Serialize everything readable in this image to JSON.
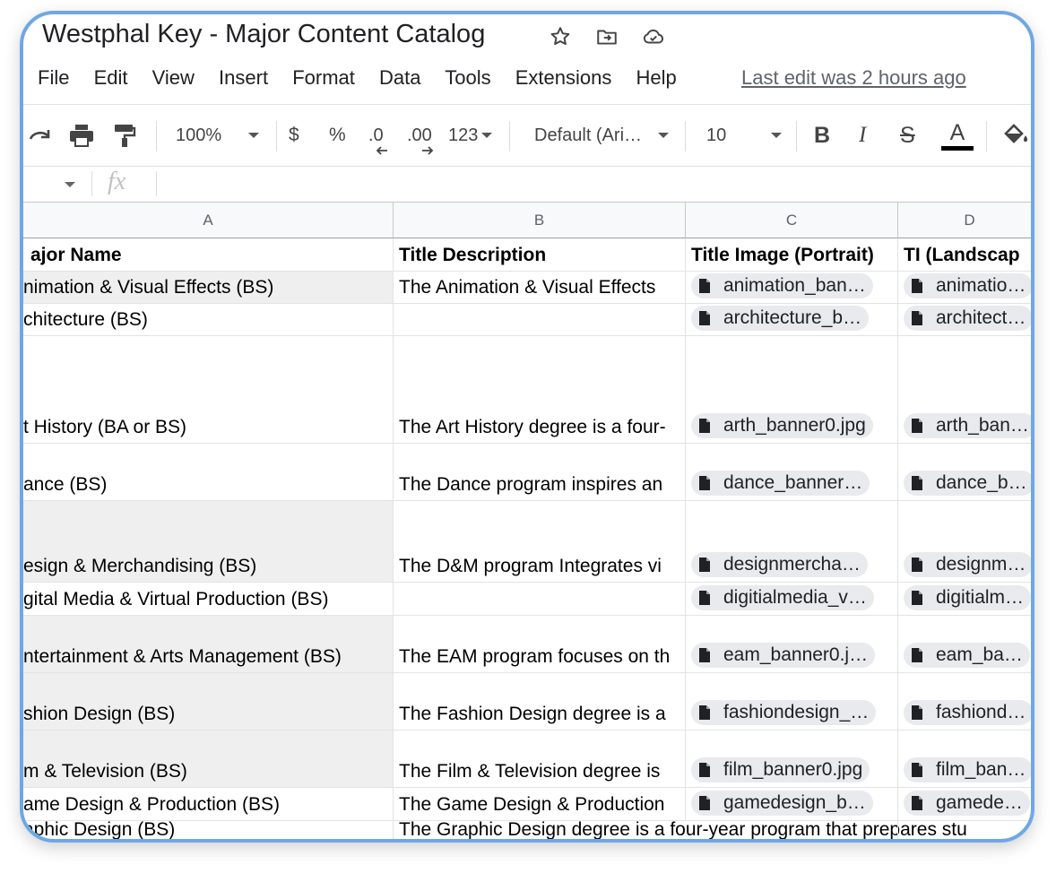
{
  "doc": {
    "title": "Westphal Key - Major Content Catalog",
    "last_edit": "Last edit was 2 hours ago"
  },
  "menu": [
    "File",
    "Edit",
    "View",
    "Insert",
    "Format",
    "Data",
    "Tools",
    "Extensions",
    "Help"
  ],
  "toolbar": {
    "zoom": "100%",
    "currency": "$",
    "percent": "%",
    "decrease_decimal": ".0",
    "increase_decimal": ".00",
    "number_format": "123",
    "font": "Default (Ari…",
    "font_size": "10",
    "bold": "B",
    "italic": "I",
    "strike": "S",
    "text_color": "A"
  },
  "formula_bar": {
    "fx": "fx"
  },
  "columns": [
    "A",
    "B",
    "C",
    "D"
  ],
  "header_row": [
    "ajor Name",
    "Title Description",
    "Title Image (Portrait)",
    "TI (Landscap"
  ],
  "rows": [
    {
      "a": "nimation & Visual Effects (BS)",
      "b": "The Animation & Visual Effects",
      "c": "animation_ban…",
      "d": "animatio…"
    },
    {
      "a": "chitecture (BS)",
      "b": "",
      "c": "architecture_b…",
      "d": "architect…"
    },
    {
      "a": "t History (BA or BS)",
      "b": "The Art History degree is a four-",
      "c": "arth_banner0.jpg",
      "d": "arth_ban…"
    },
    {
      "a": "ance (BS)",
      "b": "The Dance program inspires an",
      "c": "dance_banner…",
      "d": "dance_b…"
    },
    {
      "a": "esign & Merchandising (BS)",
      "b": "The D&M program Integrates vi",
      "c": "designmercha…",
      "d": "designm…"
    },
    {
      "a": "gital Media & Virtual Production (BS)",
      "b": "",
      "c": "digitialmedia_v…",
      "d": "digitialm…"
    },
    {
      "a": "ntertainment & Arts Management (BS)",
      "b": "The EAM program focuses on th",
      "c": "eam_banner0.j…",
      "d": "eam_ba…"
    },
    {
      "a": "shion Design (BS)",
      "b": "The Fashion Design degree is a",
      "c": "fashiondesign_…",
      "d": "fashiond…"
    },
    {
      "a": "m & Television (BS)",
      "b": "The Film & Television degree is",
      "c": "film_banner0.jpg",
      "d": "film_ban…"
    },
    {
      "a": "ame Design & Production (BS)",
      "b": "The Game Design & Production",
      "c": "gamedesign_b…",
      "d": "gamede…"
    },
    {
      "a": "aphic Design (BS)",
      "b": "The Graphic Design degree is a four-year program that prepares stu",
      "c": "",
      "d": ""
    }
  ],
  "colors": {
    "frame": "#6ea8e4",
    "note": "#f4b400",
    "grey_cell": "#efefef"
  }
}
